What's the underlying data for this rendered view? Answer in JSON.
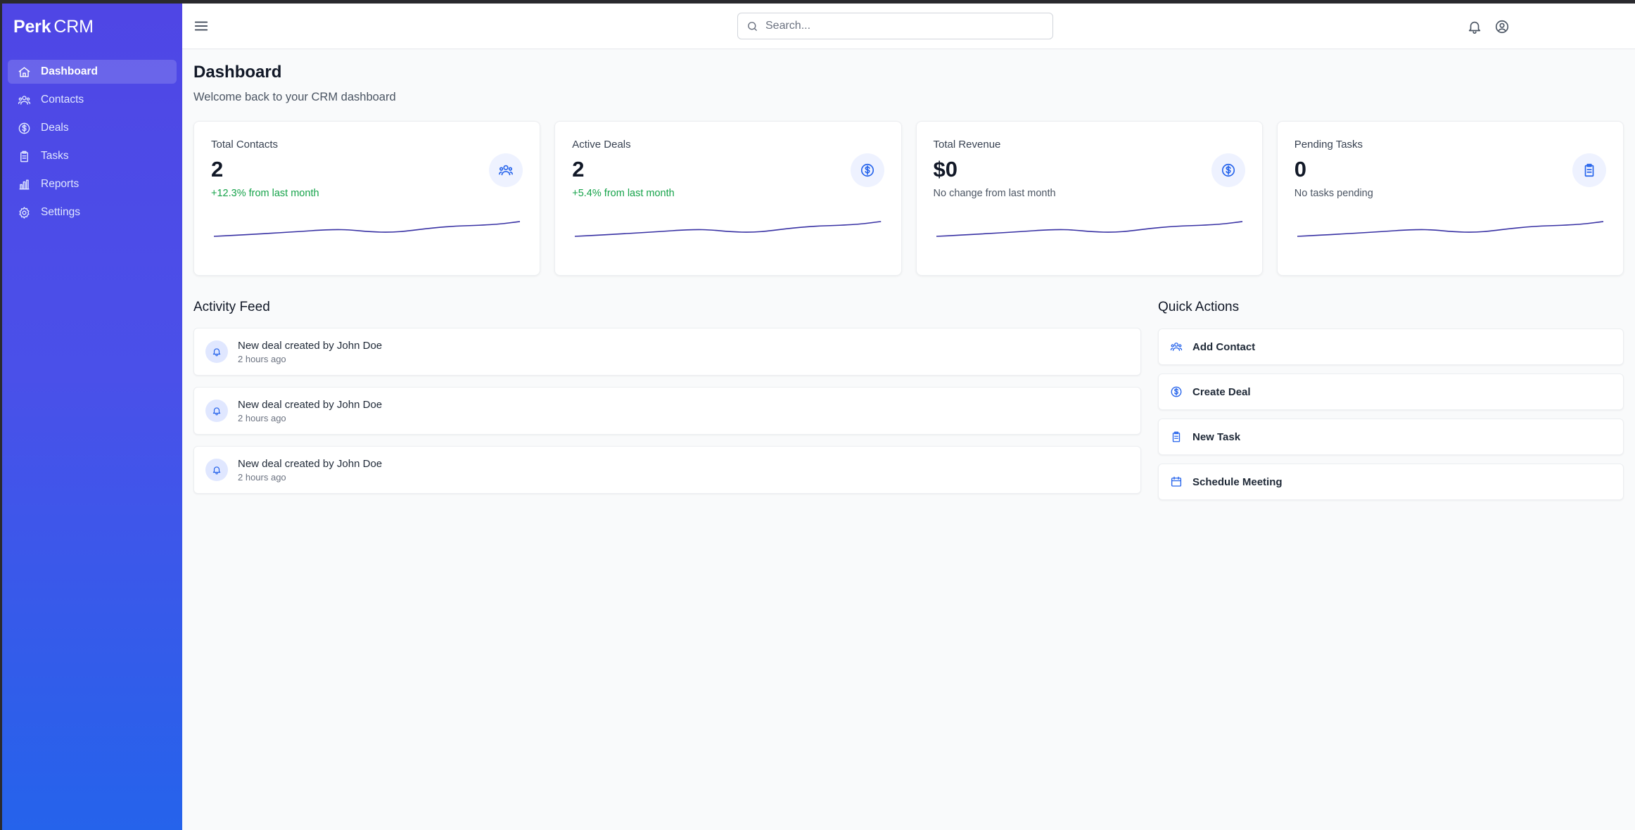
{
  "brand": {
    "name_bold": "Perk",
    "name_light": "CRM"
  },
  "sidebar": {
    "items": [
      {
        "label": "Dashboard",
        "icon": "home-icon",
        "active": true
      },
      {
        "label": "Contacts",
        "icon": "users-icon",
        "active": false
      },
      {
        "label": "Deals",
        "icon": "dollar-icon",
        "active": false
      },
      {
        "label": "Tasks",
        "icon": "clipboard-icon",
        "active": false
      },
      {
        "label": "Reports",
        "icon": "bar-chart-icon",
        "active": false
      },
      {
        "label": "Settings",
        "icon": "gear-icon",
        "active": false
      }
    ]
  },
  "topbar": {
    "search_placeholder": "Search...",
    "icons": [
      "menu-icon",
      "search-icon",
      "bell-icon",
      "user-circle-icon"
    ]
  },
  "page": {
    "title": "Dashboard",
    "subtitle": "Welcome back to your CRM dashboard"
  },
  "stats": [
    {
      "label": "Total Contacts",
      "value": "2",
      "change": "+12.3% from last month",
      "change_color": "#16a34a",
      "icon": "users-icon"
    },
    {
      "label": "Active Deals",
      "value": "2",
      "change": "+5.4% from last month",
      "change_color": "#16a34a",
      "icon": "dollar-icon"
    },
    {
      "label": "Total Revenue",
      "value": "$0",
      "change": "No change from last month",
      "change_color": "#4b5563",
      "icon": "dollar-icon"
    },
    {
      "label": "Pending Tasks",
      "value": "0",
      "change": "No tasks pending",
      "change_color": "#4b5563",
      "icon": "clipboard-icon"
    }
  ],
  "activity": {
    "title": "Activity Feed",
    "items": [
      {
        "text": "New deal created by John Doe",
        "time": "2 hours ago",
        "icon": "bell-icon"
      },
      {
        "text": "New deal created by John Doe",
        "time": "2 hours ago",
        "icon": "bell-icon"
      },
      {
        "text": "New deal created by John Doe",
        "time": "2 hours ago",
        "icon": "bell-icon"
      }
    ]
  },
  "quick_actions": {
    "title": "Quick Actions",
    "items": [
      {
        "label": "Add Contact",
        "icon": "users-icon"
      },
      {
        "label": "Create Deal",
        "icon": "dollar-icon"
      },
      {
        "label": "New Task",
        "icon": "clipboard-icon"
      },
      {
        "label": "Schedule Meeting",
        "icon": "calendar-icon"
      }
    ]
  },
  "colors": {
    "accent": "#4f46e5",
    "sidebar_top": "#4f46e5",
    "sidebar_bottom": "#2563eb",
    "positive": "#16a34a",
    "sparkline": "#3730a3"
  }
}
